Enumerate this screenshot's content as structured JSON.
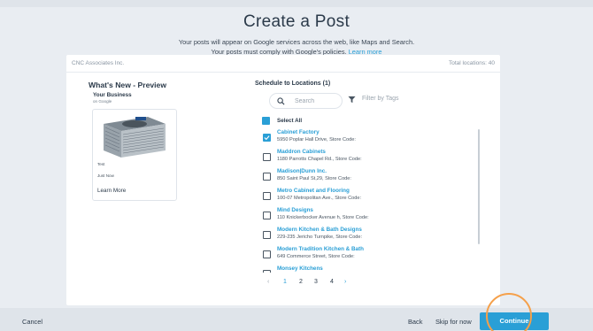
{
  "header": {
    "title": "Create a Post",
    "subtitle_line1": "Your posts will appear on Google services across the web, like Maps and Search.",
    "subtitle_line2": "Your posts must comply with Google's policies.",
    "learn_more": "Learn more"
  },
  "card": {
    "company": "CNC Associates Inc.",
    "total_locations": "Total locations: 40"
  },
  "preview": {
    "title": "What's New - Preview",
    "business": "Your Business",
    "on_google": "on Google",
    "text": "Test",
    "time": "Just Now",
    "learn_more": "Learn More",
    "image_icon": "air-conditioner-image"
  },
  "schedule": {
    "title": "Schedule to Locations (1)",
    "search_placeholder": "Search",
    "filter_label": "Filter by Tags",
    "select_all": "Select All",
    "locations": [
      {
        "name": "Cabinet Factory",
        "address": "5950 Poplar Hall Drive, Store Code:",
        "checked": true
      },
      {
        "name": "Maddron Cabinets",
        "address": "1180 Parrotts Chapel Rd., Store Code:",
        "checked": false
      },
      {
        "name": "Madison|Dunn Inc.",
        "address": "850 Saint Paul St,29, Store Code:",
        "checked": false
      },
      {
        "name": "Metro Cabinet and Flooring",
        "address": "100-07 Metropolitan Ave., Store Code:",
        "checked": false
      },
      {
        "name": "Mind Designs",
        "address": "110 Knickerbocker Avenue h, Store Code:",
        "checked": false
      },
      {
        "name": "Modern Kitchen & Bath Designs",
        "address": "229-235 Jericho Turnpike, Store Code:",
        "checked": false
      },
      {
        "name": "Modern Tradition Kitchen & Bath",
        "address": "649 Commerce Street, Store Code:",
        "checked": false
      },
      {
        "name": "Monsey Kitchens",
        "address": "",
        "checked": false
      }
    ],
    "pagination": {
      "prev": "‹",
      "pages": [
        "1",
        "2",
        "3",
        "4"
      ],
      "current": "1",
      "next": "›"
    }
  },
  "footer": {
    "cancel": "Cancel",
    "back": "Back",
    "skip": "Skip for now",
    "continue": "Continue"
  },
  "colors": {
    "accent": "#2a9fd6",
    "highlight_ring": "#f5a04a",
    "background": "#e9edf2"
  }
}
